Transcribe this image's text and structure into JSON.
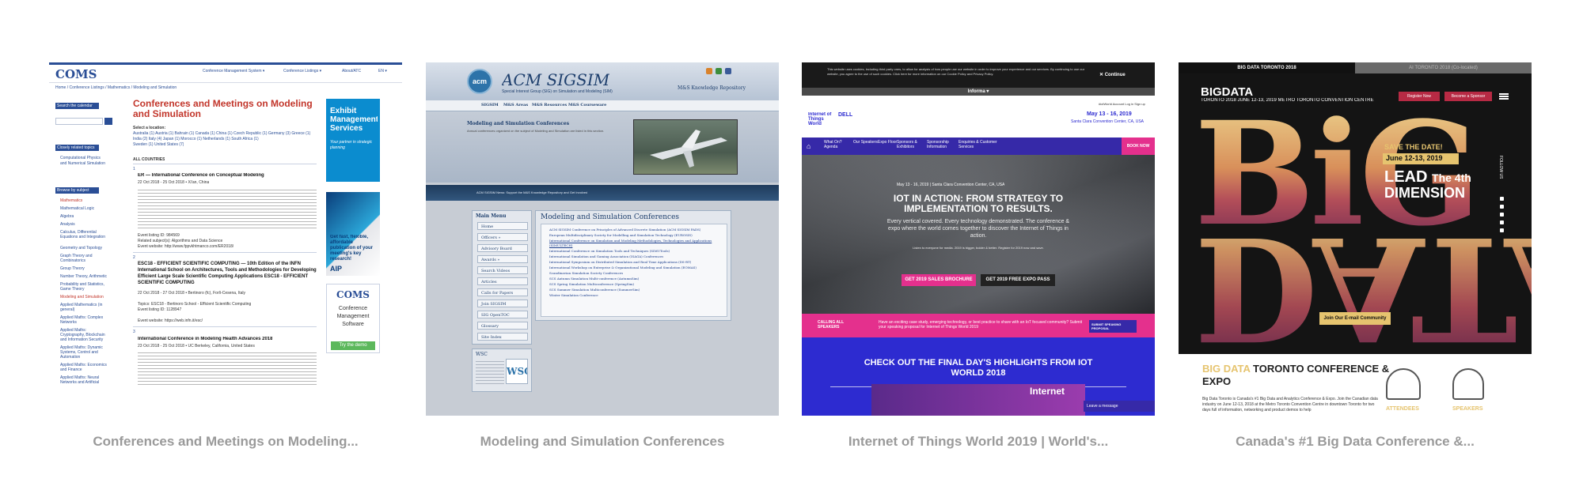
{
  "cards": [
    {
      "caption": "Conferences and Meetings on Modeling...",
      "site": {
        "logo": "COMS",
        "nav": [
          "Conference Management System ▾",
          "Conference Listings ▾",
          "About/ATC",
          "EN ▾"
        ],
        "breadcrumb": "Home / Conference Listings / Mathematics / Modeling and Simulation",
        "search_label": "Search the calendar",
        "related_label": "Closely related topics",
        "related_item": "Computational Physics and Numerical Simulation",
        "browse_label": "Browse by subject",
        "subjects": [
          "Mathematics",
          "Mathematical Logic",
          "Algebra",
          "Analysis",
          "Calculus, Differential Equations and Integration",
          "Geometry and Topology",
          "Graph Theory and Combinatorics",
          "Group Theory",
          "Number Theory, Arithmetic",
          "Probability and Statistics, Game Theory",
          "Modeling and Simulation",
          "Applied Mathematics (in general)",
          "Applied Maths: Complex Networks",
          "Applied Maths: Cryptography, Blockchain and Information Security",
          "Applied Maths: Dynamic Systems, Control and Automation",
          "Applied Maths: Economics and Finance",
          "Applied Maths: Neural Networks and Artificial"
        ],
        "title": "Conferences and Meetings on Modeling and Simulation",
        "select_location": "Select a location:",
        "locations": "Australia (1)   Austria (1)   Bahrain (1)   Canada (1)   China (1)   Czech Republic (1)   Germany (3)   Greece (1)",
        "locations2": "India (2)   Italy (4)   Japan (1)   Morocco (1)   Netherlands (1)   South Africa (1)",
        "locations3": "Sweden (1)   United States (7)",
        "all_countries": "ALL COUNTRIES",
        "entries": [
          {
            "num": "1",
            "title": "ER — International Conference on Conceptual Modeling",
            "date": "22 Oct 2018 - 25 Oct 2018 • Xi'an, China",
            "listing": "Event listing ID: 984569",
            "related": "Related subject(s): Algorithms and Data Science",
            "website": "Event website: http://www.fppvkhtmanco.com/ER2018/"
          },
          {
            "num": "2",
            "title": "ESC18 - EFFICIENT SCIENTIFIC COMPUTING — 10th Edition of the INFN International School on Architectures, Tools and Methodologies for Developing Efficient Large Scale Scientific Computing Applications ESC18 - EFFICIENT SCIENTIFIC COMPUTING",
            "date": "22 Oct 2018 - 27 Oct 2018 • Bertinoro (fc), Forlì-Cesena, Italy",
            "listing": "Topics: ESC18 - Bertinoro School - Efficient Scientific Computing",
            "related": "Event listing ID: 1128947",
            "website": "Event website: https://web.infn.it/esc/"
          },
          {
            "num": "3",
            "title": "International Conference in Modeling Health Advances 2018",
            "date": "23 Oct 2018 - 25 Oct 2018 • UC Berkeley, California, United States",
            "listing": "",
            "related": "",
            "website": ""
          }
        ],
        "ads": {
          "ad1_title": "Exhibit Management Services",
          "ad1_sub": "Your partner in strategic planning",
          "ad2_text": "Get fast, flexible, affordable publication of your meeting's key research!",
          "ad2_brand": "AIP",
          "ad3_title": "COMS",
          "ad3_text": "Conference Management Software",
          "ad3_button": "Try the demo"
        }
      }
    },
    {
      "caption": "Modeling and Simulation Conferences",
      "site": {
        "logo": "acm",
        "name": "ACM SIGSIM",
        "subtitle": "Special Interest Group (SIG) on Simulation and Modeling (SIM)",
        "tagline": "M&S Knowledge Repository",
        "menu": [
          "SIGSIM",
          "M&S Areas",
          "M&S Resources",
          "M&S Courseware"
        ],
        "section_title": "Modeling and Simulation Conferences",
        "section_sub": "Annual conferences organized on the subject of Modeling and Simulation are listed in this section.",
        "strip_text": "ACM SIGSIM News: Support the M&S Knowledge Repository and Get Involved",
        "mainmenu_title": "Main Menu",
        "mainmenu": [
          "Home",
          "Officers »",
          "Advisory Board",
          "Awards »",
          "Search Videos",
          "Articles",
          "Calls for Papers",
          "Join SIGSIM",
          "SIG OpenTOC",
          "Glossary",
          "Site Index"
        ],
        "wsc_title": "WSC",
        "wsc_logo": "WSC",
        "list_title": "Modeling and Simulation Conferences",
        "list": [
          "ACM SIGSIM Conference on Principles of Advanced Discrete Simulation (ACM SIGSIM PADS)",
          "European Multidisciplinary Society for Modelling and Simulation Technology (EUROSIS)",
          "International Conference on Simulation and Modeling Methodologies, Technologies and Applications (SIMULTECH)",
          "International Conference on Simulation Tools and Techniques (SIMUTools)",
          "International Simulation and Gaming Association (ISAGA) Conferences",
          "International Symposium on Distributed Simulation and Real Time Applications (DS-RT)",
          "International Workshop on Enterprise & Organizational Modeling and Simulation (EOMAS)",
          "Scandinavian Simulation Society Conferences",
          "SCS Autumn Simulation Multi-conference (AutumnSim)",
          "SCS Spring Simulation Multiconference (SpringSim)",
          "SCS Summer Simulation Multiconference (SummerSim)",
          "Winter Simulation Conference"
        ]
      }
    },
    {
      "caption": "Internet of Things World 2019 | World's...",
      "site": {
        "cookie_text": "This website uses cookies, including third party ones, to allow for analysis of how people use our website in order to improve your experience and our services. By continuing to use our website, you agree to the use of such cookies. Click here for more information on our Cookie Policy and Privacy Policy.",
        "cookie_button": "Continue",
        "informa": "Informa ▾",
        "logo": "Internet of Things World",
        "sponsor": "DELL",
        "account": "#iotWorld Account   Log in  Sign up",
        "date": "May 13 - 16, 2019",
        "venue": "Santa Clara Convention Center, CA, USA",
        "nav": [
          "What On? Agenda",
          "Our Speakers",
          "Expo Floor",
          "Sponsors & Exhibitors",
          "Sponsorship Information",
          "Enquiries & Customer Services"
        ],
        "book": "BOOK NOW",
        "hero_date": "May 13 - 16, 2019   |   Santa Clara Convention Center, CA, USA",
        "hero_title": "IOT IN ACTION: FROM STRATEGY TO IMPLEMENTATION TO RESULTS.",
        "hero_sub": "Every vertical covered. Every technology demonstrated. The conference & expo where the world comes together to discover the Internet of Things in action.",
        "hero_sub2": "Listen to everyone for media. 2019 is bigger, bolder & better. Register for 2019 now and save.",
        "btn_brochure": "GET 2019 SALES BROCHURE",
        "btn_pass": "GET 2019 FREE EXPO PASS",
        "calling": "CALLING ALL SPEAKERS",
        "calling_text": "Have an exciting case study, emerging technology, or best practice to share with an IoT focused community? Submit your speaking proposal for Internet of Things World 2019",
        "submit": "SUBMIT SPEAKING PROPOSAL",
        "highlights": "CHECK OUT THE FINAL DAY'S HIGHLIGHTS FROM IOT WORLD 2018",
        "banner": "Internet",
        "chat": "Leave a message"
      }
    },
    {
      "caption": "Canada's #1 Big Data Conference &...",
      "site": {
        "tab_active": "BIG DATA TORONTO 2018",
        "tab_inactive": "AI TORONTO 2018 (Co-located)",
        "logo": "BIGDATA",
        "logo_sub": "TORONTO 2018   JUNE 12-13, 2019 METRO TORONTO CONVENTION CENTRE",
        "btn_register": "Register Now",
        "btn_sponsor": "Become a Sponsor",
        "hero_word": "BiG",
        "hero_word_flip": "DATA",
        "save": "SAVE THE DATE!",
        "dates": "June 12-13, 2019",
        "lead": "LEAD",
        "lead_the": "The 4th",
        "dimension": "DIMENSION",
        "follow": "FOLLOW US",
        "email_button": "Join Our E-mail Community",
        "conf_title_a": "BIG DATA",
        "conf_title_b": " TORONTO CONFERENCE & EXPO",
        "desc": "Big Data Toronto is Canada's #1 Big Data and Analytics Conference & Expo. Join the Canadian data industry on June 12-13, 2018 at the Metro Toronto Convention Centre in downtown Toronto for two days full of information, networking and product demos to help",
        "attendees": "ATTENDEES",
        "speakers": "SPEAKERS"
      }
    }
  ],
  "colors": {
    "caption": "#9a9a9a",
    "coms_blue": "#2a4e96",
    "coms_red": "#c2352a",
    "iot_purple": "#3629a8",
    "iot_pink": "#e4308d",
    "bigdata_gold": "#e6c46f"
  }
}
